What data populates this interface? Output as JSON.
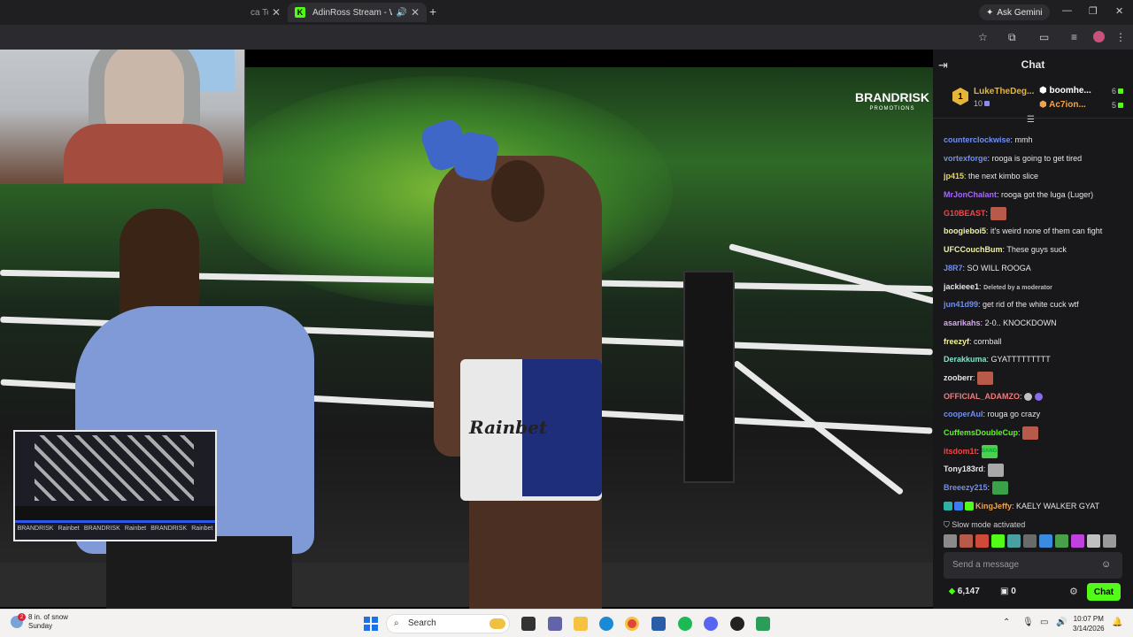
{
  "browser": {
    "tabs": [
      {
        "label": "ca Tea",
        "active": false
      },
      {
        "label": "AdinRoss Stream - Watch L",
        "active": true,
        "icon": "kick-logo",
        "logo_letter": "K",
        "audio_icon": "🔊"
      }
    ],
    "new_tab": "+",
    "ask_gemini": "Ask Gemini",
    "gemini_icon": "✦",
    "window_controls": [
      "—",
      "❐",
      "✕"
    ]
  },
  "video": {
    "brand_logo": "BRANDRISK",
    "brand_sub": "PROMOTIONS",
    "trunks_text": "Rainbet",
    "pip_logos": [
      "BRANDRISK",
      "Rainbet",
      "BRANDRISK",
      "Rainbet",
      "BRANDRISK",
      "Rainbet"
    ]
  },
  "chat": {
    "title": "Chat",
    "leaderboard": [
      {
        "rank": "1",
        "name": "LukeTheDeg...",
        "count": "10"
      },
      {
        "name": "boomhe...",
        "count": "6"
      },
      {
        "name": "Ac7ion...",
        "count": "5"
      }
    ],
    "messages": [
      {
        "user": "counterclockwise",
        "color": "#6f8ff2",
        "text": "mmh"
      },
      {
        "user": "vortexforge",
        "color": "#6f8ff2",
        "text": "rooga is going to get tired"
      },
      {
        "user": "jp415",
        "color": "#e9d94a",
        "text": "the next kimbo slice"
      },
      {
        "user": "MrJonChalant",
        "color": "#a56af2",
        "text": "rooga got the luga (Luger)"
      },
      {
        "user": "G10BEAST",
        "color": "#f04848",
        "text": "",
        "emote": "emote"
      },
      {
        "user": "boogieboi5",
        "color": "#f2f2a0",
        "text": "it's weird none of them can fight"
      },
      {
        "user": "UFCCouchBum",
        "color": "#f2f2a0",
        "text": "These guys suck"
      },
      {
        "user": "J8R7",
        "color": "#6f8ff2",
        "text": "SO WILL ROOGA"
      },
      {
        "user": "jackieee1",
        "color": "#e6e6e6",
        "text": "Deleted by a moderator",
        "moderated": true
      },
      {
        "user": "jun41d99",
        "color": "#6f8ff2",
        "text": "get rid of the white cuck wtf"
      },
      {
        "user": "asarikahs",
        "color": "#d9a6f2",
        "text": "2-0.. KNOCKDOWN"
      },
      {
        "user": "freezyf",
        "color": "#f2f2a0",
        "text": "cornball"
      },
      {
        "user": "Derakkuma",
        "color": "#86e0c8",
        "text": "GYATTTTTTTTT"
      },
      {
        "user": "zooberr",
        "color": "#e6e6e6",
        "text": "",
        "emote": "emote"
      },
      {
        "user": "OFFICIAL_ADAMZO",
        "color": "#f27a7a",
        "text": "",
        "emote": "small-emotes"
      },
      {
        "user": "cooperAul",
        "color": "#6f8ff2",
        "text": "rouga go crazy"
      },
      {
        "user": "CuffemsDoubleCup",
        "color": "#53fc18",
        "text": "",
        "emote": "emote"
      },
      {
        "user": "itsdom1t",
        "color": "#f04848",
        "text": "",
        "emote": "bang-emote",
        "emote_text": "BANG"
      },
      {
        "user": "Tony183rd",
        "color": "#e6e6e6",
        "text": "",
        "emote": "cat-emote"
      },
      {
        "user": "Breeezy215",
        "color": "#6f8ff2",
        "text": "",
        "emote": "pepe-emote"
      },
      {
        "user": "KingJeffy",
        "color": "#f2a34a",
        "text": "KAELY WALKER GYAT",
        "badges": [
          "#2bb3a8",
          "#3a7af2",
          "#53fc18"
        ]
      }
    ],
    "slow_mode": "Slow mode activated",
    "input_placeholder": "Send a message",
    "points": "6,147",
    "gifts": "0",
    "send_label": "Chat"
  },
  "taskbar": {
    "weather_line1": "8 in. of snow",
    "weather_line2": "Sunday",
    "notification_count": "2",
    "search_placeholder": "Search",
    "time": "10:07 PM",
    "date": "3/14/2026"
  }
}
